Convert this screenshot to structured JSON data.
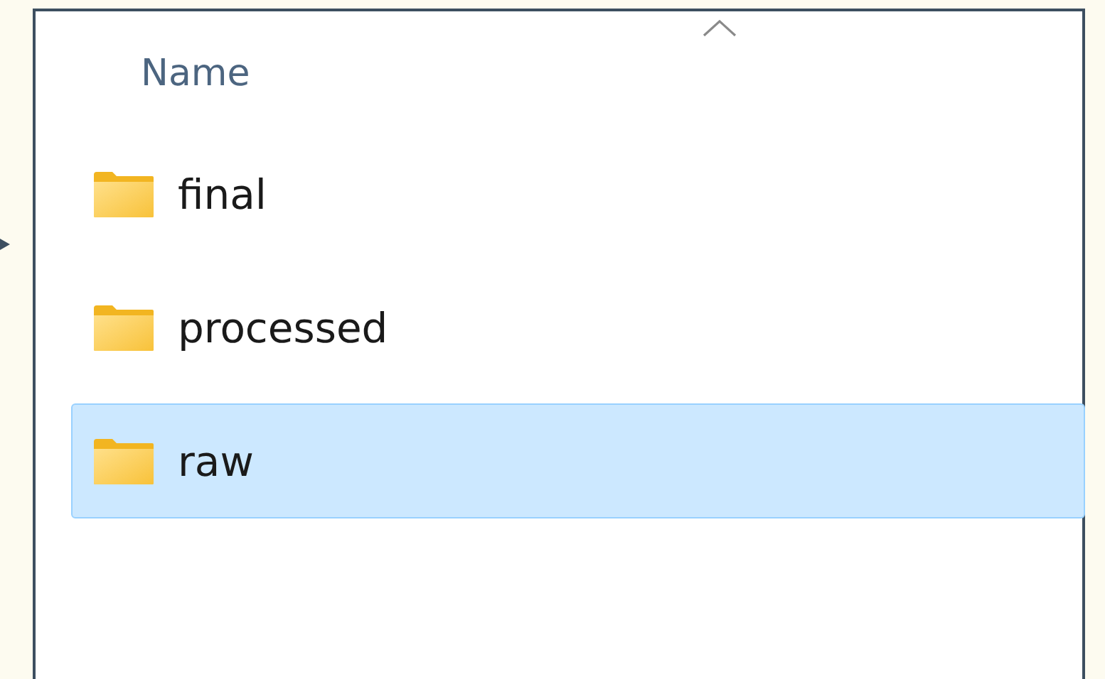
{
  "header": {
    "column": "Name",
    "sort_caret": true
  },
  "items": [
    {
      "name": "final",
      "selected": false
    },
    {
      "name": "processed",
      "selected": false
    },
    {
      "name": "raw",
      "selected": true
    }
  ]
}
